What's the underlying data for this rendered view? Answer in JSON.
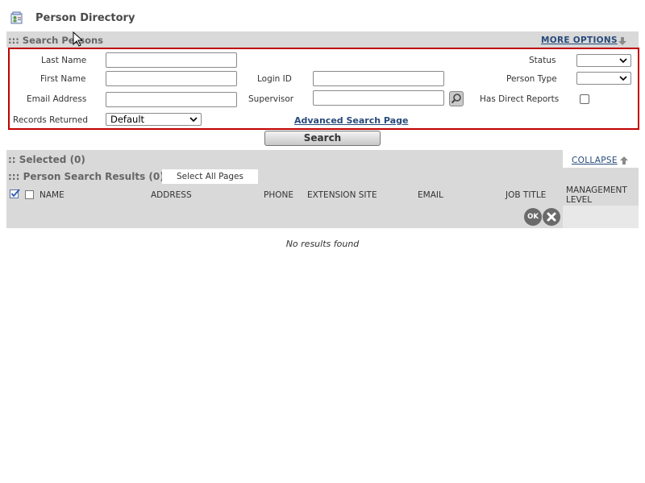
{
  "header": {
    "title": "Person Directory",
    "icon": "directory-card-icon"
  },
  "search_persons": {
    "title": "::: Search Persons",
    "more_options": "MORE OPTIONS",
    "more_options_icon": "arrow-down-icon"
  },
  "form": {
    "last_name_label": "Last Name",
    "first_name_label": "First Name",
    "email_label": "Email Address",
    "records_label": "Records Returned",
    "records_value": "Default",
    "login_id_label": "Login ID",
    "supervisor_label": "Supervisor",
    "status_label": "Status",
    "status_value": "",
    "person_type_label": "Person Type",
    "person_type_value": "",
    "direct_reports_label": "Has Direct Reports",
    "advanced_link": "Advanced Search Page",
    "lookup_icon": "magnifier-icon"
  },
  "search_button": "Search",
  "selected": {
    "title": ":: Selected (0)",
    "collapse": "COLLAPSE",
    "collapse_icon": "arrow-up-icon"
  },
  "results": {
    "title": "::: Person Search Results (0)",
    "select_all_pages": "Select All Pages",
    "columns": [
      "NAME",
      "ADDRESS",
      "PHONE",
      "EXTENSION SITE",
      "EMAIL",
      "JOB TITLE",
      "MANAGEMENT",
      "LEVEL"
    ],
    "ok_label": "OK",
    "no_results": "No results found"
  },
  "colors": {
    "accent_link": "#274a7a",
    "highlight_border": "#c00000",
    "bar_gray": "#d9d9d9"
  }
}
